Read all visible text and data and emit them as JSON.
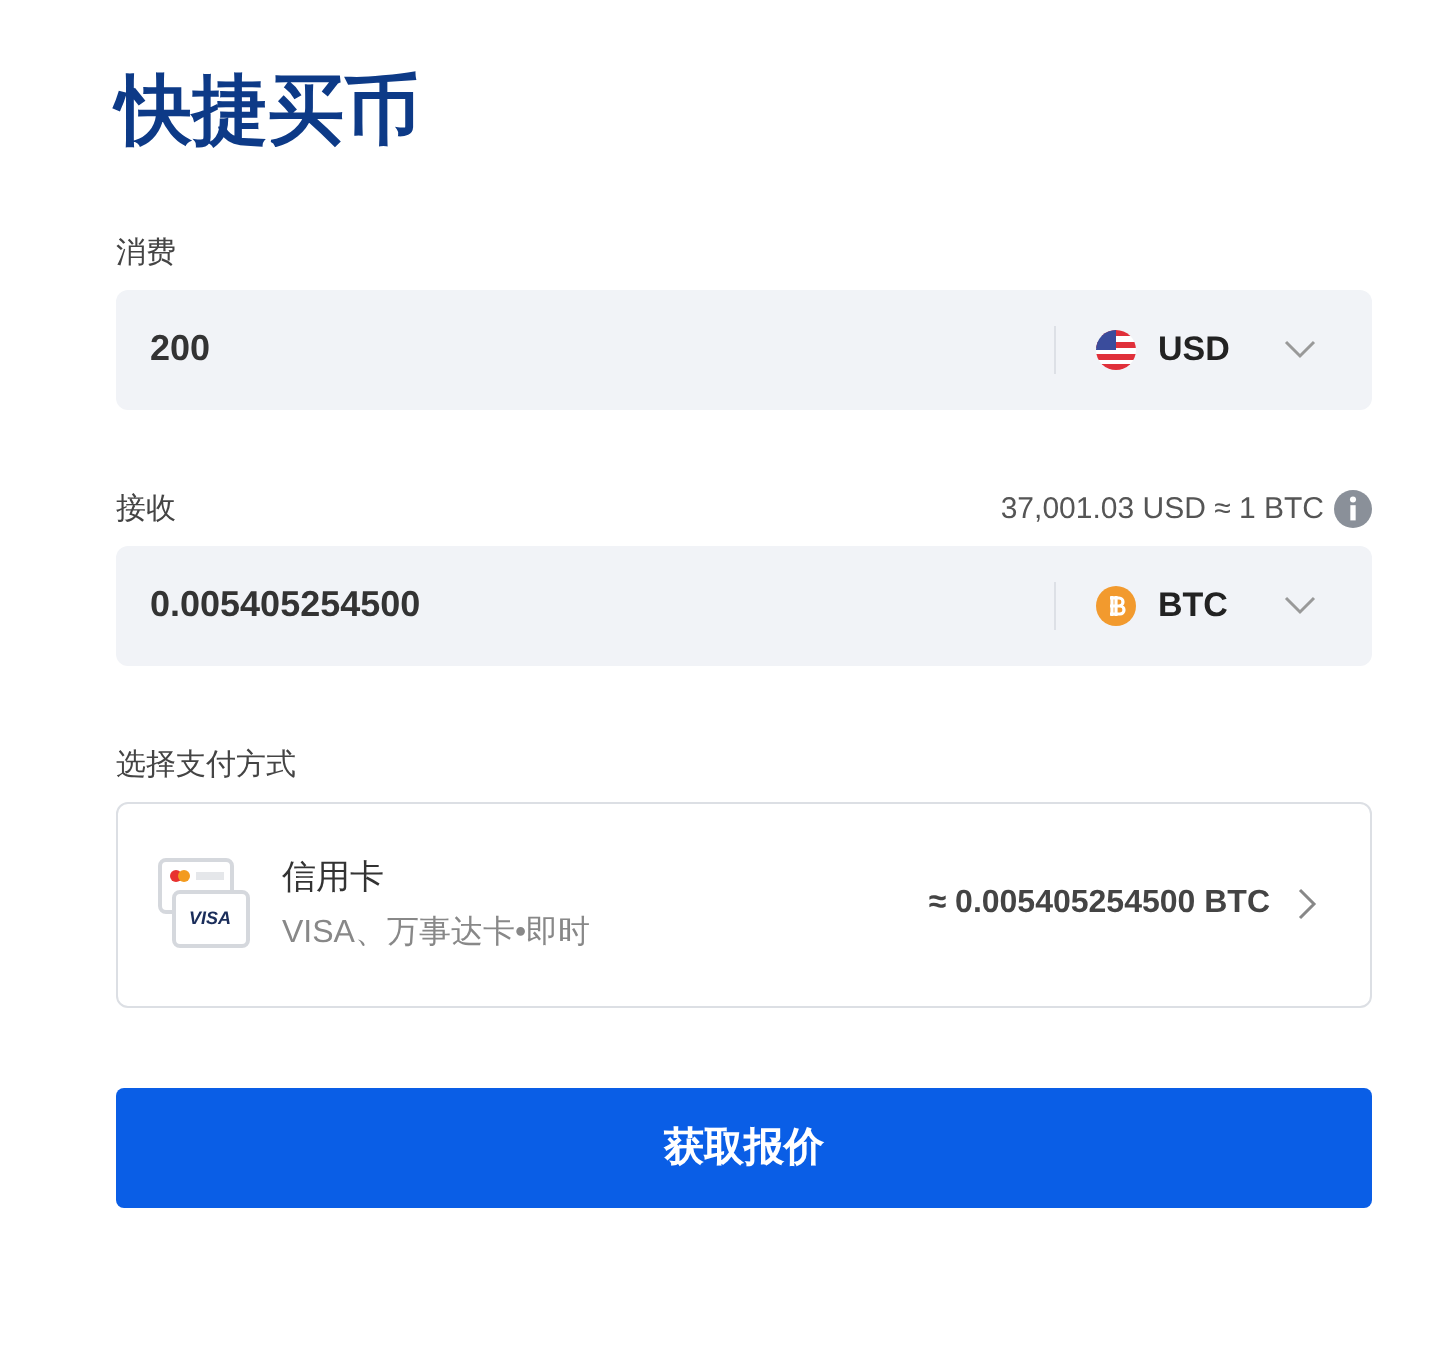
{
  "title": "快捷买币",
  "spend": {
    "label": "消费",
    "value": "200",
    "currency": "USD"
  },
  "receive": {
    "label": "接收",
    "rate": "37,001.03 USD ≈ 1 BTC",
    "value": "0.005405254500",
    "currency": "BTC"
  },
  "payment": {
    "label": "选择支付方式",
    "icon_text": "VISA",
    "name": "信用卡",
    "detail": "VISA、万事达卡•即时",
    "amount": "≈ 0.005405254500 BTC"
  },
  "button": "获取报价"
}
